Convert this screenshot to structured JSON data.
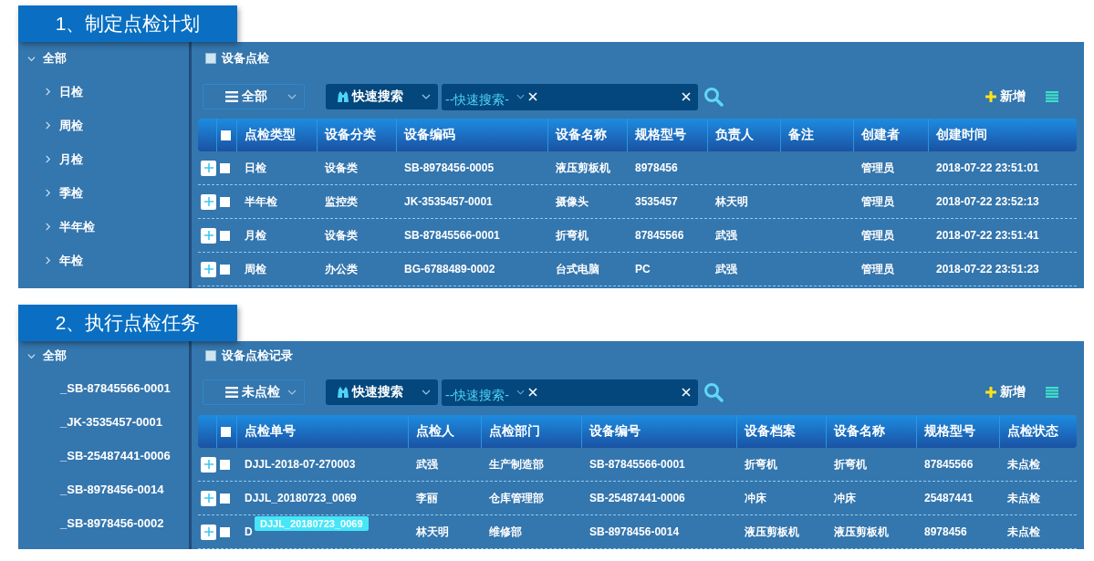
{
  "panels": [
    {
      "step_title": "1、制定点检计划",
      "tree": {
        "label": "全部",
        "expanded": true,
        "children": [
          {
            "label": "日检",
            "expanded": false
          },
          {
            "label": "周检",
            "expanded": false
          },
          {
            "label": "月检",
            "expanded": false
          },
          {
            "label": "季检",
            "expanded": false
          },
          {
            "label": "半年检",
            "expanded": false
          },
          {
            "label": "年检",
            "expanded": false
          }
        ]
      },
      "section_title": "设备点检",
      "filter": {
        "value": "全部"
      },
      "search_mode": "快速搜索",
      "search": {
        "placeholder": "--快速搜索-"
      },
      "add_button": "新增",
      "table": {
        "header_checked": false,
        "columns": [
          "点检类型",
          "设备分类",
          "设备编码",
          "设备名称",
          "规格型号",
          "负责人",
          "备注",
          "创建者",
          "创建时间"
        ],
        "rows": [
          {
            "checked": false,
            "cells": [
              "日检",
              "设备类",
              "SB-8978456-0005",
              "液压剪板机",
              "8978456",
              "",
              "",
              "管理员",
              "2018-07-22 23:51:01"
            ]
          },
          {
            "checked": false,
            "cells": [
              "半年检",
              "监控类",
              "JK-3535457-0001",
              "摄像头",
              "3535457",
              "林天明",
              "",
              "管理员",
              "2018-07-22 23:52:13"
            ]
          },
          {
            "checked": false,
            "cells": [
              "月检",
              "设备类",
              "SB-87845566-0001",
              "折弯机",
              "87845566",
              "武强",
              "",
              "管理员",
              "2018-07-22 23:51:41"
            ]
          },
          {
            "checked": false,
            "cells": [
              "周检",
              "办公类",
              "BG-6788489-0002",
              "台式电脑",
              "PC",
              "武强",
              "",
              "管理员",
              "2018-07-22 23:51:23"
            ]
          }
        ]
      }
    },
    {
      "step_title": "2、执行点检任务",
      "tree": {
        "label": "全部",
        "expanded": true,
        "children": [
          {
            "label": "_SB-87845566-0001"
          },
          {
            "label": "_JK-3535457-0001"
          },
          {
            "label": "_SB-25487441-0006"
          },
          {
            "label": "_SB-8978456-0014"
          },
          {
            "label": "_SB-8978456-0002"
          }
        ]
      },
      "section_title": "设备点检记录",
      "filter": {
        "value": "未点检"
      },
      "search_mode": "快速搜索",
      "search": {
        "placeholder": "--快速搜索-"
      },
      "add_button": "新增",
      "table": {
        "header_checked": false,
        "columns": [
          "点检单号",
          "点检人",
          "点检部门",
          "设备编号",
          "设备档案",
          "设备名称",
          "规格型号",
          "点检状态"
        ],
        "rows": [
          {
            "checked": false,
            "cells": [
              "DJJL-2018-07-270003",
              "武强",
              "生产制造部",
              "SB-87845566-0001",
              "折弯机",
              "折弯机",
              "87845566",
              "未点检"
            ]
          },
          {
            "checked": false,
            "cells": [
              "DJJL_20180723_0069",
              "李丽",
              "仓库管理部",
              "SB-25487441-0006",
              "冲床",
              "冲床",
              "25487441",
              "未点检"
            ]
          },
          {
            "checked": false,
            "tooltip": "DJJL_20180723_0069",
            "cells": [
              "D",
              "林天明",
              "维修部",
              "SB-8978456-0014",
              "液压剪板机",
              "液压剪板机",
              "8978456",
              "未点检"
            ]
          }
        ]
      }
    }
  ]
}
